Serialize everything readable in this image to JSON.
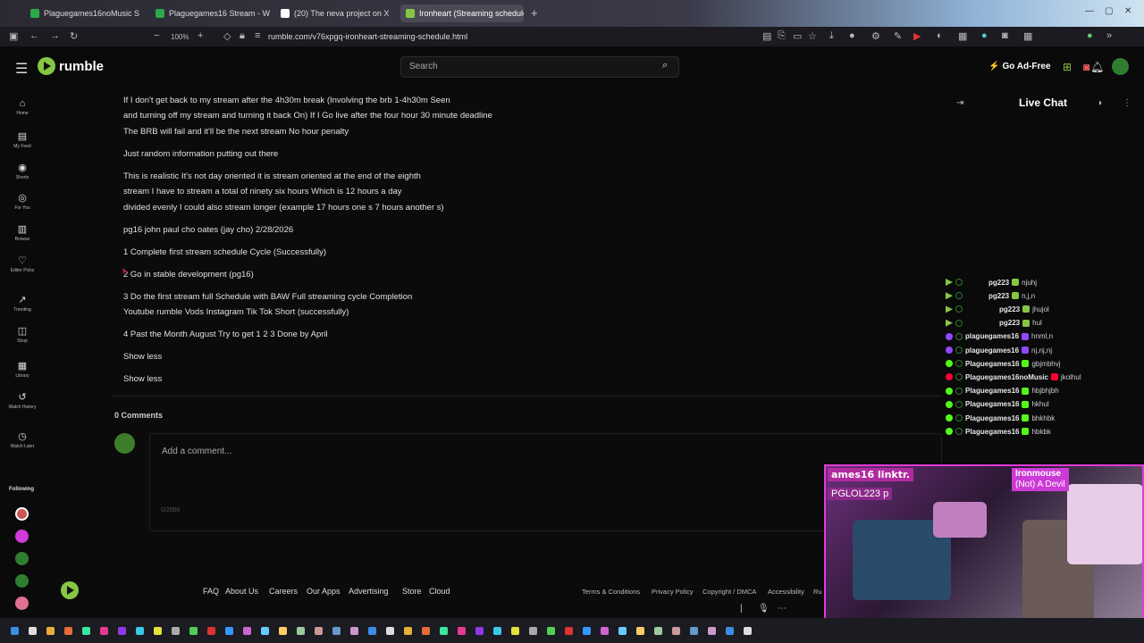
{
  "browser": {
    "tabs": [
      {
        "label": "Plaguegames16noMusic Strea",
        "color": "#2aa84a"
      },
      {
        "label": "Plaguegames16 Stream - Watc",
        "color": "#2aa84a"
      },
      {
        "label": "(20) The neva project on X",
        "color": "#ffffff"
      },
      {
        "label": "Ironheart (Streaming schedule)",
        "color": "#85c742"
      }
    ],
    "zoom": "100%",
    "url": "rumble.com/v76xpgq-ironheart-streaming-schedule.html"
  },
  "header": {
    "logo_text": "rumble",
    "search_placeholder": "Search",
    "go_ad_free": "Go Ad-Free"
  },
  "sidebar": {
    "items": [
      {
        "icon": "home-icon",
        "glyph": "⌂",
        "label": "Home"
      },
      {
        "icon": "feed-icon",
        "glyph": "▤",
        "label": "My Feed"
      },
      {
        "icon": "shorts-icon",
        "glyph": "◉",
        "label": "Shorts"
      },
      {
        "icon": "for-you-icon",
        "glyph": "◎",
        "label": "For You"
      },
      {
        "icon": "browse-icon",
        "glyph": "▥",
        "label": "Browse"
      },
      {
        "icon": "editor-picks-icon",
        "glyph": "♡",
        "label": "Editor Picks"
      },
      {
        "icon": "trending-icon",
        "glyph": "↗",
        "label": "Trending"
      },
      {
        "icon": "shop-icon",
        "glyph": "◫",
        "label": "Shop"
      },
      {
        "icon": "library-icon",
        "glyph": "▦",
        "label": "Library"
      },
      {
        "icon": "watch-history-icon",
        "glyph": "↺",
        "label": "Watch History"
      },
      {
        "icon": "watch-later-icon",
        "glyph": "◷",
        "label": "Watch Later"
      }
    ],
    "following_label": "Following"
  },
  "description": {
    "lines": [
      "If I don't get back to my stream after the 4h30m break (Involving the brb 1-4h30m Seen",
      "and turning off my stream and turning it back On) If I Go live after the four hour 30 minute deadline",
      "The BRB will fail and it'll be the next stream No hour penalty",
      "Just random information putting out there",
      "This is realistic It's not day oriented it is stream oriented at the end of the eighth",
      "stream I have to stream a total of ninety six hours Which is 12 hours a day",
      "divided evenly I could also stream longer (example 17 hours one s 7 hours another s)",
      "pg16 john paul cho oates (jay cho) 2/28/2026",
      "1 Complete first stream schedule Cycle (Successfully)",
      "2 Go in stable development (pg16)",
      "3 Do the first stream full Schedule with BAW Full streaming cycle Completion",
      "Youtube rumble Vods Instagram Tik Tok Short (successfully)",
      "4 Past the Month August Try to get 1 2 3 Done by April"
    ],
    "show_less_inner": "Show less",
    "show_less_outer": "Show less"
  },
  "comments": {
    "count_label": "0 Comments",
    "placeholder": "Add a comment...",
    "counter": "0/2000"
  },
  "footer": {
    "links": [
      "FAQ",
      "About Us",
      "Careers",
      "Our Apps",
      "Advertising",
      "Store",
      "Cloud"
    ],
    "small_links": [
      "Terms & Conditions",
      "Privacy Policy",
      "Copyright / DMCA",
      "Accessibility",
      "Ru"
    ]
  },
  "chat": {
    "title": "Live Chat",
    "messages": [
      {
        "user": "pg223",
        "msg": "njuhj",
        "platform": "rumble"
      },
      {
        "user": "pg223",
        "msg": "n,j,n",
        "platform": "rumble"
      },
      {
        "user": "pg223",
        "msg": "jhujol",
        "platform": "rumble"
      },
      {
        "user": "pg223",
        "msg": "hul",
        "platform": "rumble"
      },
      {
        "user": "plaguegames16",
        "msg": "hnml,n",
        "platform": "twitch"
      },
      {
        "user": "plaguegames16",
        "msg": "nj,nj,nj",
        "platform": "twitch"
      },
      {
        "user": "Plaguegames16",
        "msg": "gbjmbhvj",
        "platform": "kick"
      },
      {
        "user": "Plaguegames16noMusic",
        "msg": "jkolhul",
        "platform": "youtube"
      },
      {
        "user": "Plaguegames16",
        "msg": "hbjbhjbh",
        "platform": "kick"
      },
      {
        "user": "Plaguegames16",
        "msg": "hkhul",
        "platform": "kick"
      },
      {
        "user": "Plaguegames16",
        "msg": "bhkhbk",
        "platform": "kick"
      },
      {
        "user": "Plaguegames16",
        "msg": "hbkbk",
        "platform": "kick"
      }
    ]
  },
  "stream_overlay": {
    "top_left": "ames16 linktr.",
    "second": "PGLOL223 p",
    "right_name": "Ironmouse",
    "right_sub": "(Not) A Devil"
  },
  "colors": {
    "brand": "#85c742",
    "accent_pink": "#e23ad8"
  }
}
